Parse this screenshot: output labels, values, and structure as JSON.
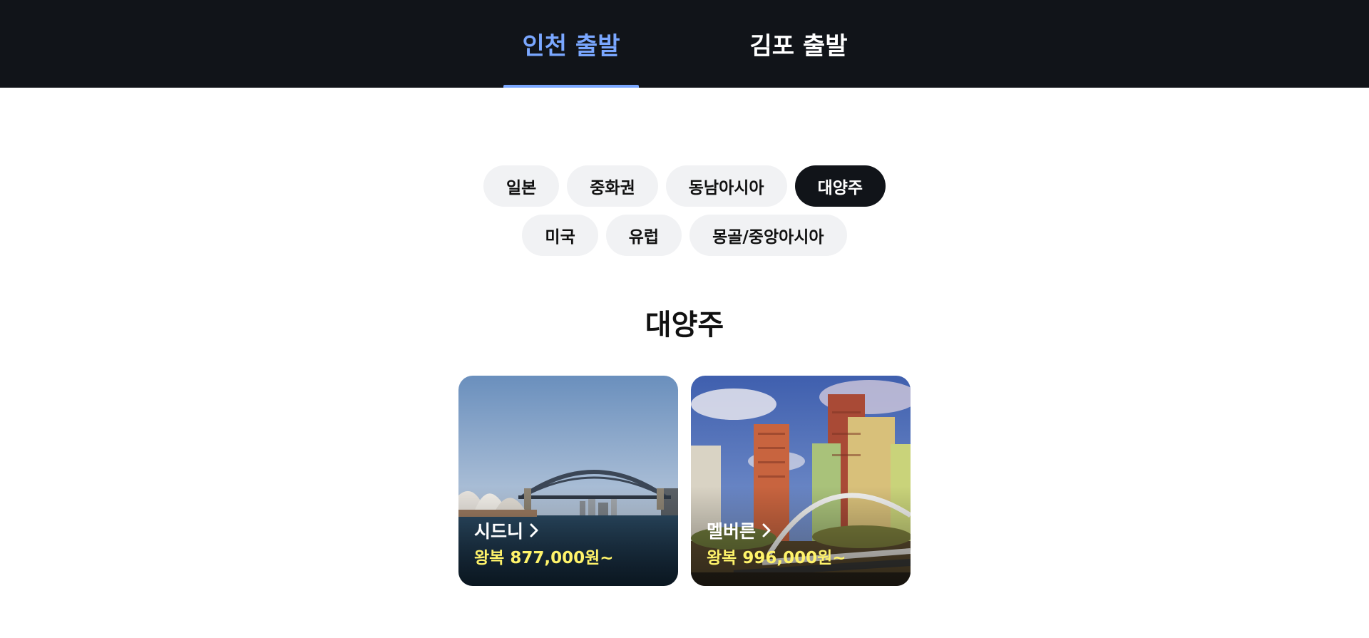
{
  "tabs": [
    {
      "label": "인천 출발",
      "active": true
    },
    {
      "label": "김포 출발",
      "active": false
    }
  ],
  "regions": {
    "row1": [
      {
        "label": "일본",
        "active": false
      },
      {
        "label": "중화권",
        "active": false
      },
      {
        "label": "동남아시아",
        "active": false
      },
      {
        "label": "대양주",
        "active": true
      }
    ],
    "row2": [
      {
        "label": "미국",
        "active": false
      },
      {
        "label": "유럽",
        "active": false
      },
      {
        "label": "몽골/중앙아시아",
        "active": false
      }
    ]
  },
  "section": {
    "title": "대양주"
  },
  "destinations": [
    {
      "city": "시드니",
      "price": "왕복 877,000원~",
      "icon": "chevron-right-icon"
    },
    {
      "city": "멜버른",
      "price": "왕복 996,000원~",
      "icon": "chevron-right-icon"
    }
  ],
  "colors": {
    "topbar_bg": "#111419",
    "active_tab": "#7aa7ff",
    "chip_bg": "#f1f2f4",
    "chip_active_bg": "#111419",
    "price": "#fff36a"
  }
}
